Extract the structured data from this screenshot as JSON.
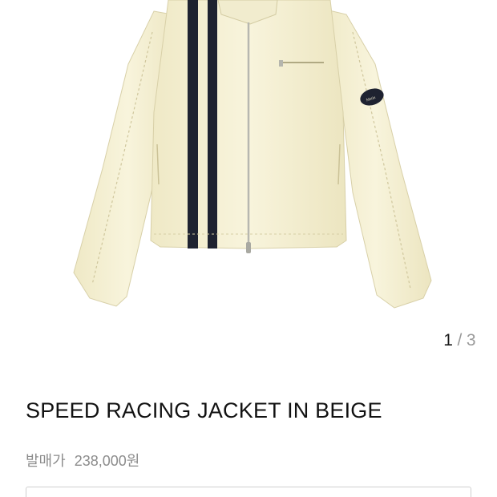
{
  "product": {
    "title": "SPEED RACING JACKET IN BEIGE",
    "price_label": "발매가",
    "price": "238,000원"
  },
  "gallery": {
    "current": "1",
    "separator": "/",
    "total": "3"
  },
  "patch_text": "Matin",
  "colors": {
    "jacket": "#f6f2d6",
    "stripe": "#1e2230",
    "muted": "#8c8c8c"
  }
}
